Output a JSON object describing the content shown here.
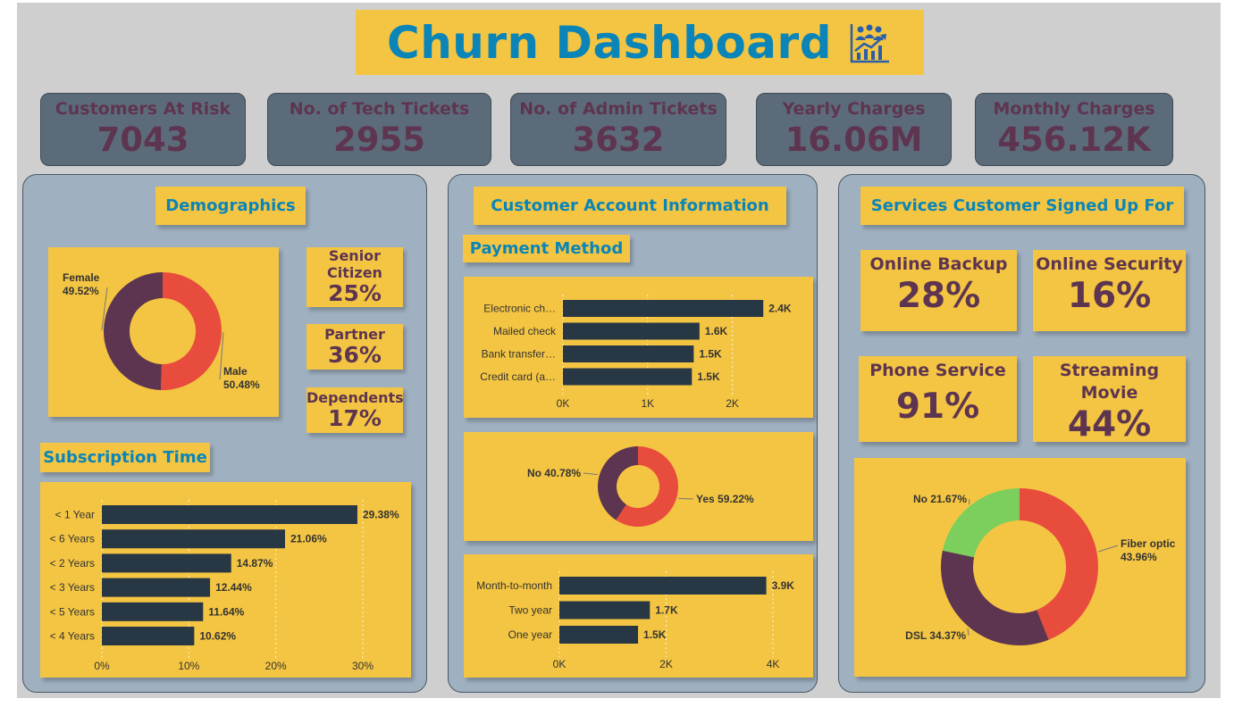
{
  "title": "Churn Dashboard",
  "kpis": [
    {
      "label": "Customers At Risk",
      "value": "7043"
    },
    {
      "label": "No. of Tech Tickets",
      "value": "2955"
    },
    {
      "label": "No. of Admin Tickets",
      "value": "3632"
    },
    {
      "label": "Yearly Charges",
      "value": "16.06M"
    },
    {
      "label": "Monthly Charges",
      "value": "456.12K"
    }
  ],
  "panels": {
    "demographics": "Demographics",
    "account": "Customer Account Information",
    "services": "Services Customer Signed Up For"
  },
  "demographics": {
    "senior": {
      "label": "Senior Citizen",
      "value": "25%"
    },
    "partner": {
      "label": "Partner",
      "value": "36%"
    },
    "dependents": {
      "label": "Dependents",
      "value": "17%"
    },
    "subscription_title": "Subscription Time"
  },
  "account": {
    "payment_title": "Payment Method"
  },
  "services": {
    "online_backup": {
      "label": "Online Backup",
      "value": "28%"
    },
    "online_security": {
      "label": "Online Security",
      "value": "16%"
    },
    "phone_service": {
      "label": "Phone Service",
      "value": "91%"
    },
    "streaming_movie": {
      "label": "Streaming Movie",
      "value": "44%"
    }
  },
  "colors": {
    "accent_blue": "#0b85b8",
    "panel_yellow": "#f4c542",
    "plum": "#5e3550",
    "red": "#e84c3d",
    "green": "#7ccf5c",
    "bar": "#273744"
  },
  "chart_data": [
    {
      "id": "gender",
      "type": "pie",
      "donut": true,
      "slices": [
        {
          "label": "Male",
          "value": 50.48,
          "display": "50.48%",
          "color": "#e84c3d"
        },
        {
          "label": "Female",
          "value": 49.52,
          "display": "49.52%",
          "color": "#5e3550"
        }
      ]
    },
    {
      "id": "subscription",
      "type": "bar",
      "orientation": "horizontal",
      "categories": [
        "< 1 Year",
        "< 6 Years",
        "< 2 Years",
        "< 3 Years",
        "< 5 Years",
        "< 4 Years"
      ],
      "values": [
        29.38,
        21.06,
        14.87,
        12.44,
        11.64,
        10.62
      ],
      "data_labels": [
        "29.38%",
        "21.06%",
        "14.87%",
        "12.44%",
        "11.64%",
        "10.62%"
      ],
      "xlim": [
        0,
        30
      ],
      "ticks": [
        0,
        10,
        20,
        30
      ],
      "tick_labels": [
        "0%",
        "10%",
        "20%",
        "30%"
      ],
      "grid": true
    },
    {
      "id": "payment",
      "type": "bar",
      "orientation": "horizontal",
      "categories": [
        "Electronic ch…",
        "Mailed check",
        "Bank transfer…",
        "Credit card (a…"
      ],
      "values": [
        2365,
        1612,
        1544,
        1522
      ],
      "data_labels": [
        "2.4K",
        "1.6K",
        "1.5K",
        "1.5K"
      ],
      "xlim": [
        0,
        2500
      ],
      "ticks": [
        0,
        1000,
        2000
      ],
      "tick_labels": [
        "0K",
        "1K",
        "2K"
      ],
      "grid": true
    },
    {
      "id": "paperless",
      "type": "pie",
      "donut": true,
      "slices": [
        {
          "label": "Yes",
          "value": 59.22,
          "display": "Yes 59.22%",
          "color": "#e84c3d"
        },
        {
          "label": "No",
          "value": 40.78,
          "display": "No 40.78%",
          "color": "#5e3550"
        }
      ]
    },
    {
      "id": "contract",
      "type": "bar",
      "orientation": "horizontal",
      "categories": [
        "Month-to-month",
        "Two year",
        "One year"
      ],
      "values": [
        3875,
        1695,
        1473
      ],
      "data_labels": [
        "3.9K",
        "1.7K",
        "1.5K"
      ],
      "xlim": [
        0,
        4200
      ],
      "ticks": [
        0,
        2000,
        4000
      ],
      "tick_labels": [
        "0K",
        "2K",
        "4K"
      ],
      "grid": true
    },
    {
      "id": "internet",
      "type": "pie",
      "donut": true,
      "slices": [
        {
          "label": "Fiber optic",
          "value": 43.96,
          "display": "Fiber optic 43.96%",
          "color": "#e84c3d"
        },
        {
          "label": "DSL",
          "value": 34.37,
          "display": "DSL 34.37%",
          "color": "#5e3550"
        },
        {
          "label": "No",
          "value": 21.67,
          "display": "No 21.67%",
          "color": "#7ccf5c"
        }
      ]
    }
  ]
}
